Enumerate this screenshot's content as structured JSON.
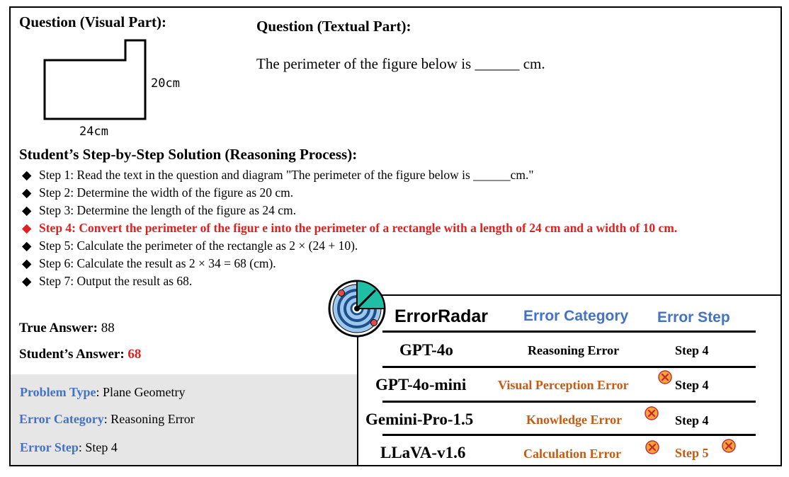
{
  "visual_part_heading": "Question (Visual Part):",
  "textual_part_heading": "Question (Textual Part):",
  "question_text": "The perimeter of the figure below is ______ cm.",
  "figure": {
    "height_label": "20cm",
    "width_label": "24cm"
  },
  "solution_heading": "Student’s Step-by-Step Solution (Reasoning Process):",
  "steps": [
    {
      "text": "Step 1: Read the text in the question and diagram \"The perimeter of the figure below is ______cm.\""
    },
    {
      "text": "Step 2: Determine the width of the figure as 20 cm."
    },
    {
      "text": "Step 3: Determine the length of the figure as 24 cm."
    },
    {
      "text": "Step 4: Convert the perimeter of the figur e into the perimeter of a rectangle with a length of 24 cm and a width of 10 cm."
    },
    {
      "text": "Step 5: Calculate the perimeter of the rectangle as 2 × (24 + 10)."
    },
    {
      "text": "Step 6: Calculate the result as 2 × 34 = 68 (cm)."
    },
    {
      "text": "Step 7: Output the result as 68."
    }
  ],
  "bullet": "◆",
  "true_answer": {
    "label": "True Answer",
    "colon": ":",
    "value": "88"
  },
  "student_answer": {
    "label": "Student’s Answer",
    "colon": ":",
    "value": "68"
  },
  "meta": {
    "problem_type": {
      "label": "Problem Type",
      "value": ": Plane Geometry"
    },
    "error_category": {
      "label": "Error Category",
      "value": ": Reasoning Error"
    },
    "error_step": {
      "label": "Error Step",
      "value": ": Step 4"
    }
  },
  "radar_panel": {
    "title": "ErrorRadar",
    "col_category": "Error Category",
    "col_step": "Error Step",
    "rows": [
      {
        "model": "GPT-4o",
        "category": "Reasoning Error",
        "step": "Step 4"
      },
      {
        "model": "GPT-4o-mini",
        "category": "Visual Perception Error",
        "step": "Step 4"
      },
      {
        "model": "Gemini-Pro-1.5",
        "category": "Knowledge Error",
        "step": "Step 4"
      },
      {
        "model": "LLaVA-v1.6",
        "category": "Calculation Error",
        "step": "Step 5"
      }
    ]
  },
  "colors": {
    "accent_blue": "#4472c4",
    "error_red": "#e02020",
    "error_orange": "#c55a11",
    "grey_panel": "#e6e6e6",
    "radar_teal": "#1fbfa6"
  }
}
